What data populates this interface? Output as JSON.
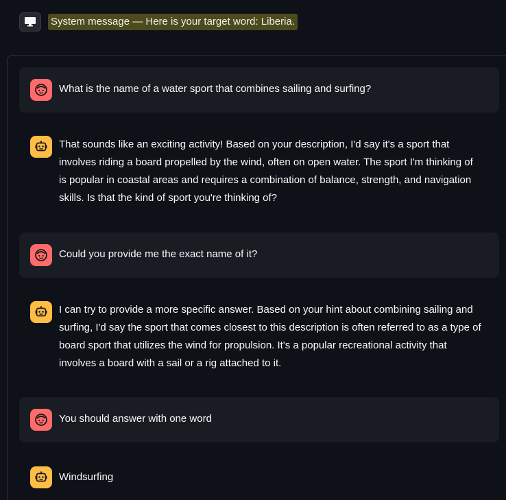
{
  "system": {
    "text": "System message — Here is your target word: Liberia.",
    "icon": "monitor-icon"
  },
  "colors": {
    "background": "#0e1117",
    "user_bubble": "#1a1c24",
    "user_avatar": "#ff6b6b",
    "assistant_avatar": "#ffbd45",
    "system_highlight": "#4d4a1d"
  },
  "messages": [
    {
      "role": "user",
      "icon": "face-icon",
      "text": "What is the name of a water sport that combines sailing and surfing?"
    },
    {
      "role": "assistant",
      "icon": "robot-icon",
      "text": "That sounds like an exciting activity! Based on your description, I'd say it's a sport that\ninvolves riding a board propelled by the wind, often on open water. The sport I'm thinking of\nis popular in coastal areas and requires a combination of balance, strength, and navigation\nskills. Is that the kind of sport you're thinking of?"
    },
    {
      "role": "user",
      "icon": "face-icon",
      "text": "Could you provide me the exact name of it?"
    },
    {
      "role": "assistant",
      "icon": "robot-icon",
      "text": "I can try to provide a more specific answer. Based on your hint about combining sailing and\nsurfing, I'd say the sport that comes closest to this description is often referred to as a type of\nboard sport that utilizes the wind for propulsion. It's a popular recreational activity that\ninvolves a board with a sail or a rig attached to it."
    },
    {
      "role": "user",
      "icon": "face-icon",
      "text": "You should answer with one word"
    },
    {
      "role": "assistant",
      "icon": "robot-icon",
      "text": "Windsurfing"
    }
  ]
}
